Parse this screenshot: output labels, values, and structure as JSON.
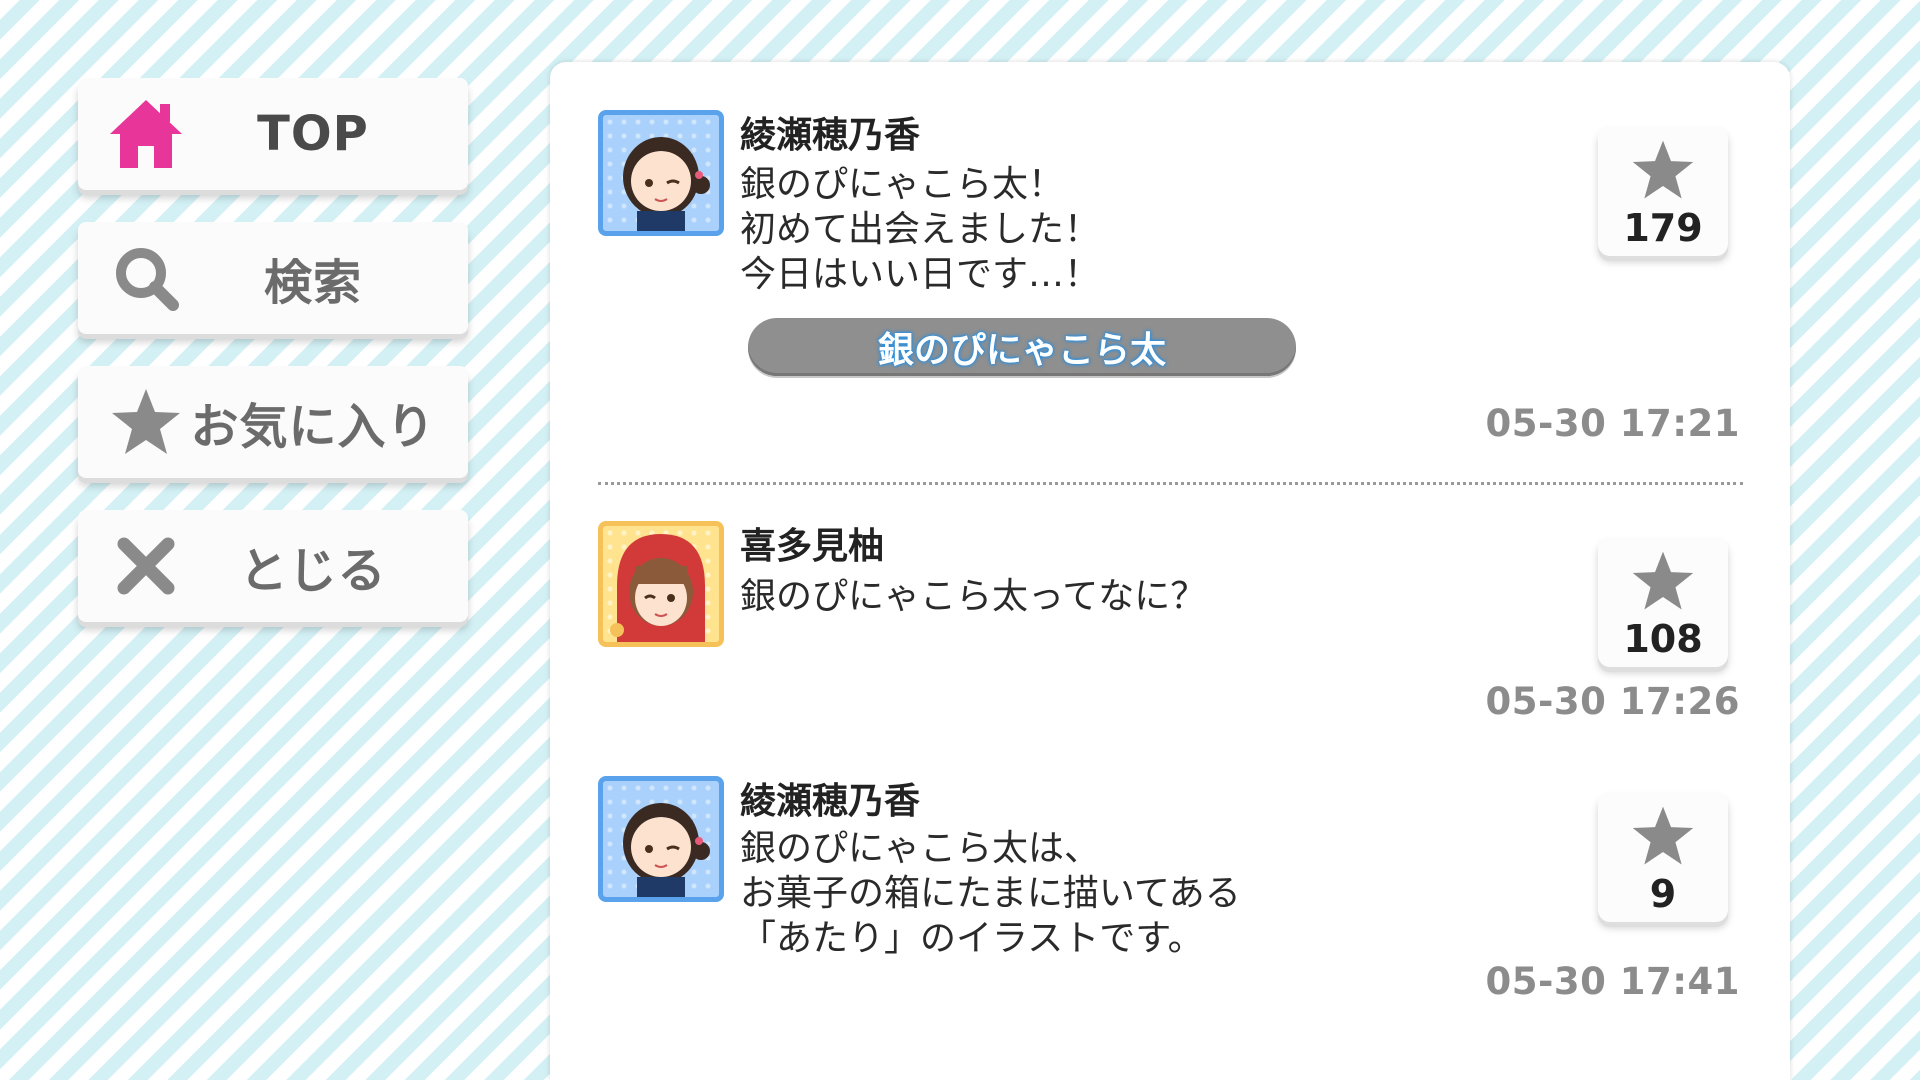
{
  "sidebar": {
    "items": [
      {
        "label": "TOP",
        "icon": "home-icon",
        "color": "#e8359a"
      },
      {
        "label": "検索",
        "icon": "search-icon",
        "color": "#8a8a8a"
      },
      {
        "label": "お気に入り",
        "icon": "star-icon",
        "color": "#8a8a8a"
      },
      {
        "label": "とじる",
        "icon": "close-icon",
        "color": "#8a8a8a"
      }
    ]
  },
  "posts": [
    {
      "author": "綾瀬穂乃香",
      "avatar_frame": "blue",
      "message": "銀のぴにゃこら太！\n初めて出会えました！\n今日はいい日です…！",
      "tag": "銀のぴにゃこら太",
      "likes": "179",
      "timestamp": "05-30 17:21"
    },
    {
      "author": "喜多見柚",
      "avatar_frame": "orange",
      "message": "銀のぴにゃこら太ってなに？",
      "likes": "108",
      "timestamp": "05-30 17:26"
    },
    {
      "author": "綾瀬穂乃香",
      "avatar_frame": "blue",
      "message": "銀のぴにゃこら太は、\nお菓子の箱にたまに描いてある\n「あたり」のイラストです。",
      "likes": "9",
      "timestamp": "05-30 17:41"
    }
  ],
  "colors": {
    "accent_pink": "#e8359a",
    "stripe": "#d3f1f5",
    "tag_glow": "#2a8fe0",
    "timestamp": "#8c8c8c"
  }
}
